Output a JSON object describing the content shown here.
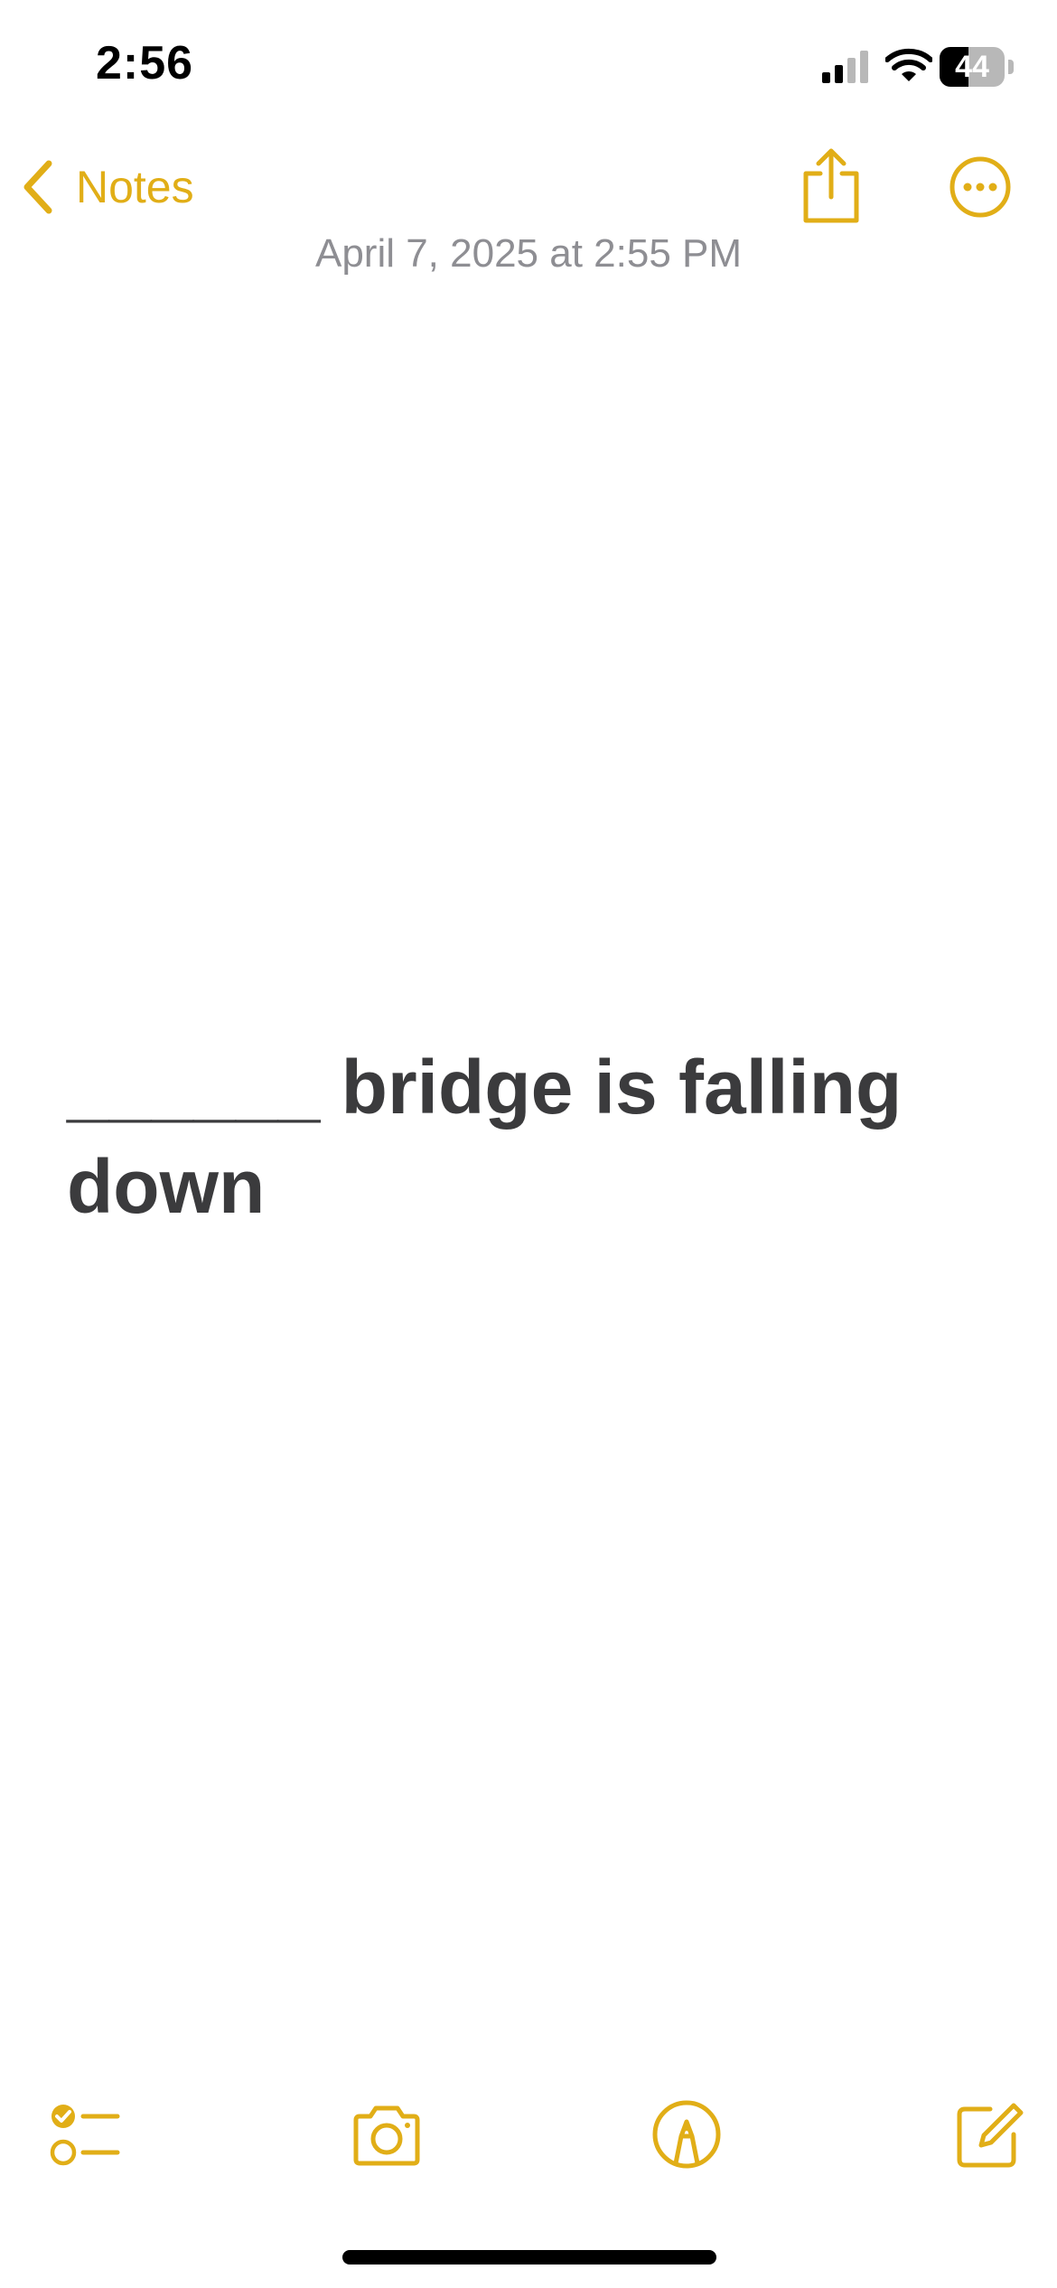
{
  "status_bar": {
    "time": "2:56",
    "battery_percent": "44",
    "battery_level": 0.44
  },
  "nav": {
    "back_label": "Notes",
    "accent_color": "#E1AE17"
  },
  "note": {
    "date": "April 7, 2025 at 2:55 PM",
    "body": "______ bridge is falling down"
  },
  "icons": {
    "back": "chevron-left-icon",
    "share": "share-icon",
    "more": "ellipsis-circle-icon",
    "checklist": "checklist-icon",
    "camera": "camera-icon",
    "markup": "markup-pen-icon",
    "compose": "compose-icon"
  }
}
